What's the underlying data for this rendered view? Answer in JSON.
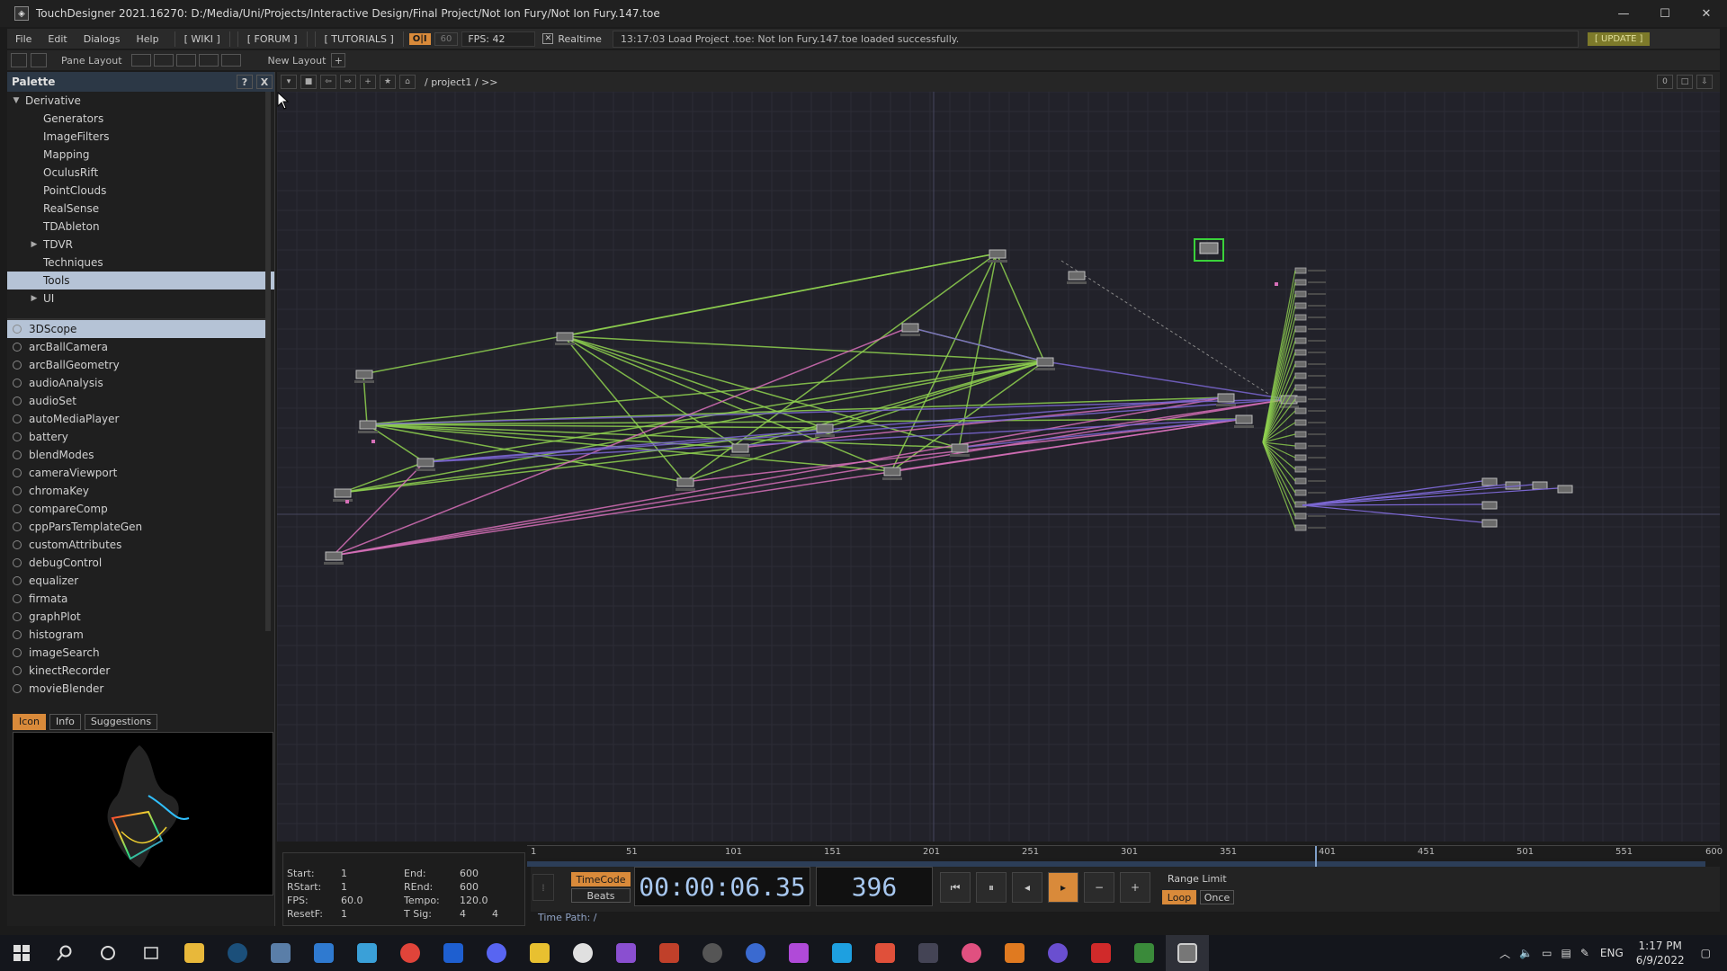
{
  "window": {
    "title": "TouchDesigner 2021.16270: D:/Media/Uni/Projects/Interactive Design/Final Project/Not Ion Fury/Not Ion Fury.147.toe"
  },
  "menu": {
    "items": [
      "File",
      "Edit",
      "Dialogs",
      "Help"
    ],
    "wiki": "[ WIKI ]",
    "forum": "[ FORUM ]",
    "tutorials": "[ TUTORIALS ]",
    "oi": "O|I",
    "fps_setting": "60",
    "fps": "FPS: 42",
    "realtime": "Realtime",
    "status": "13:17:03 Load Project .toe: Not Ion Fury.147.toe loaded successfully.",
    "update": "[ UPDATE ]"
  },
  "panebar": {
    "pane_layout": "Pane Layout",
    "new_layout": "New Layout"
  },
  "palette": {
    "title": "Palette",
    "help": "?",
    "close": "X",
    "tree": [
      {
        "label": "Derivative",
        "expand": "▼",
        "indent": 0
      },
      {
        "label": "Generators",
        "expand": "",
        "indent": 1
      },
      {
        "label": "ImageFilters",
        "expand": "",
        "indent": 1
      },
      {
        "label": "Mapping",
        "expand": "",
        "indent": 1
      },
      {
        "label": "OculusRift",
        "expand": "",
        "indent": 1
      },
      {
        "label": "PointClouds",
        "expand": "",
        "indent": 1
      },
      {
        "label": "RealSense",
        "expand": "",
        "indent": 1
      },
      {
        "label": "TDAbleton",
        "expand": "",
        "indent": 1
      },
      {
        "label": "TDVR",
        "expand": "▶",
        "indent": 1
      },
      {
        "label": "Techniques",
        "expand": "",
        "indent": 1
      },
      {
        "label": "Tools",
        "expand": "",
        "indent": 1,
        "selected": true
      },
      {
        "label": "UI",
        "expand": "▶",
        "indent": 1
      }
    ],
    "components": [
      "3DScope",
      "arcBallCamera",
      "arcBallGeometry",
      "audioAnalysis",
      "audioSet",
      "autoMediaPlayer",
      "battery",
      "blendModes",
      "cameraViewport",
      "chromaKey",
      "compareComp",
      "cppParsTemplateGen",
      "customAttributes",
      "debugControl",
      "equalizer",
      "firmata",
      "graphPlot",
      "histogram",
      "imageSearch",
      "kinectRecorder",
      "movieBlender"
    ],
    "tabs": [
      "Icon",
      "Info",
      "Suggestions"
    ]
  },
  "network": {
    "path": "/ project1 / >>",
    "right_btn": "0"
  },
  "timeline": {
    "ticks": [
      "1",
      "51",
      "101",
      "151",
      "201",
      "251",
      "301",
      "351",
      "401",
      "451",
      "501",
      "551",
      "600"
    ],
    "info": {
      "start_label": "Start:",
      "start": "1",
      "end_label": "End:",
      "end": "600",
      "rstart_label": "RStart:",
      "rstart": "1",
      "rend_label": "REnd:",
      "rend": "600",
      "fps_label": "FPS:",
      "fps": "60.0",
      "tempo_label": "Tempo:",
      "tempo": "120.0",
      "resetf_label": "ResetF:",
      "resetf": "1",
      "tsig_label": "T Sig:",
      "tsig_a": "4",
      "tsig_b": "4"
    },
    "timecode_btn": "TimeCode",
    "beats_btn": "Beats",
    "time": "00:00:06.35",
    "frame": "396",
    "range_limit": "Range Limit",
    "loop": "Loop",
    "once": "Once",
    "time_path": "Time Path: /"
  },
  "taskbar": {
    "lang": "ENG",
    "time": "1:17 PM",
    "date": "6/9/2022"
  },
  "colors": {
    "accent": "#d98a3a",
    "link_green": "#8fd14f",
    "link_pink": "#d66fb8",
    "link_purple": "#7a66d0"
  }
}
